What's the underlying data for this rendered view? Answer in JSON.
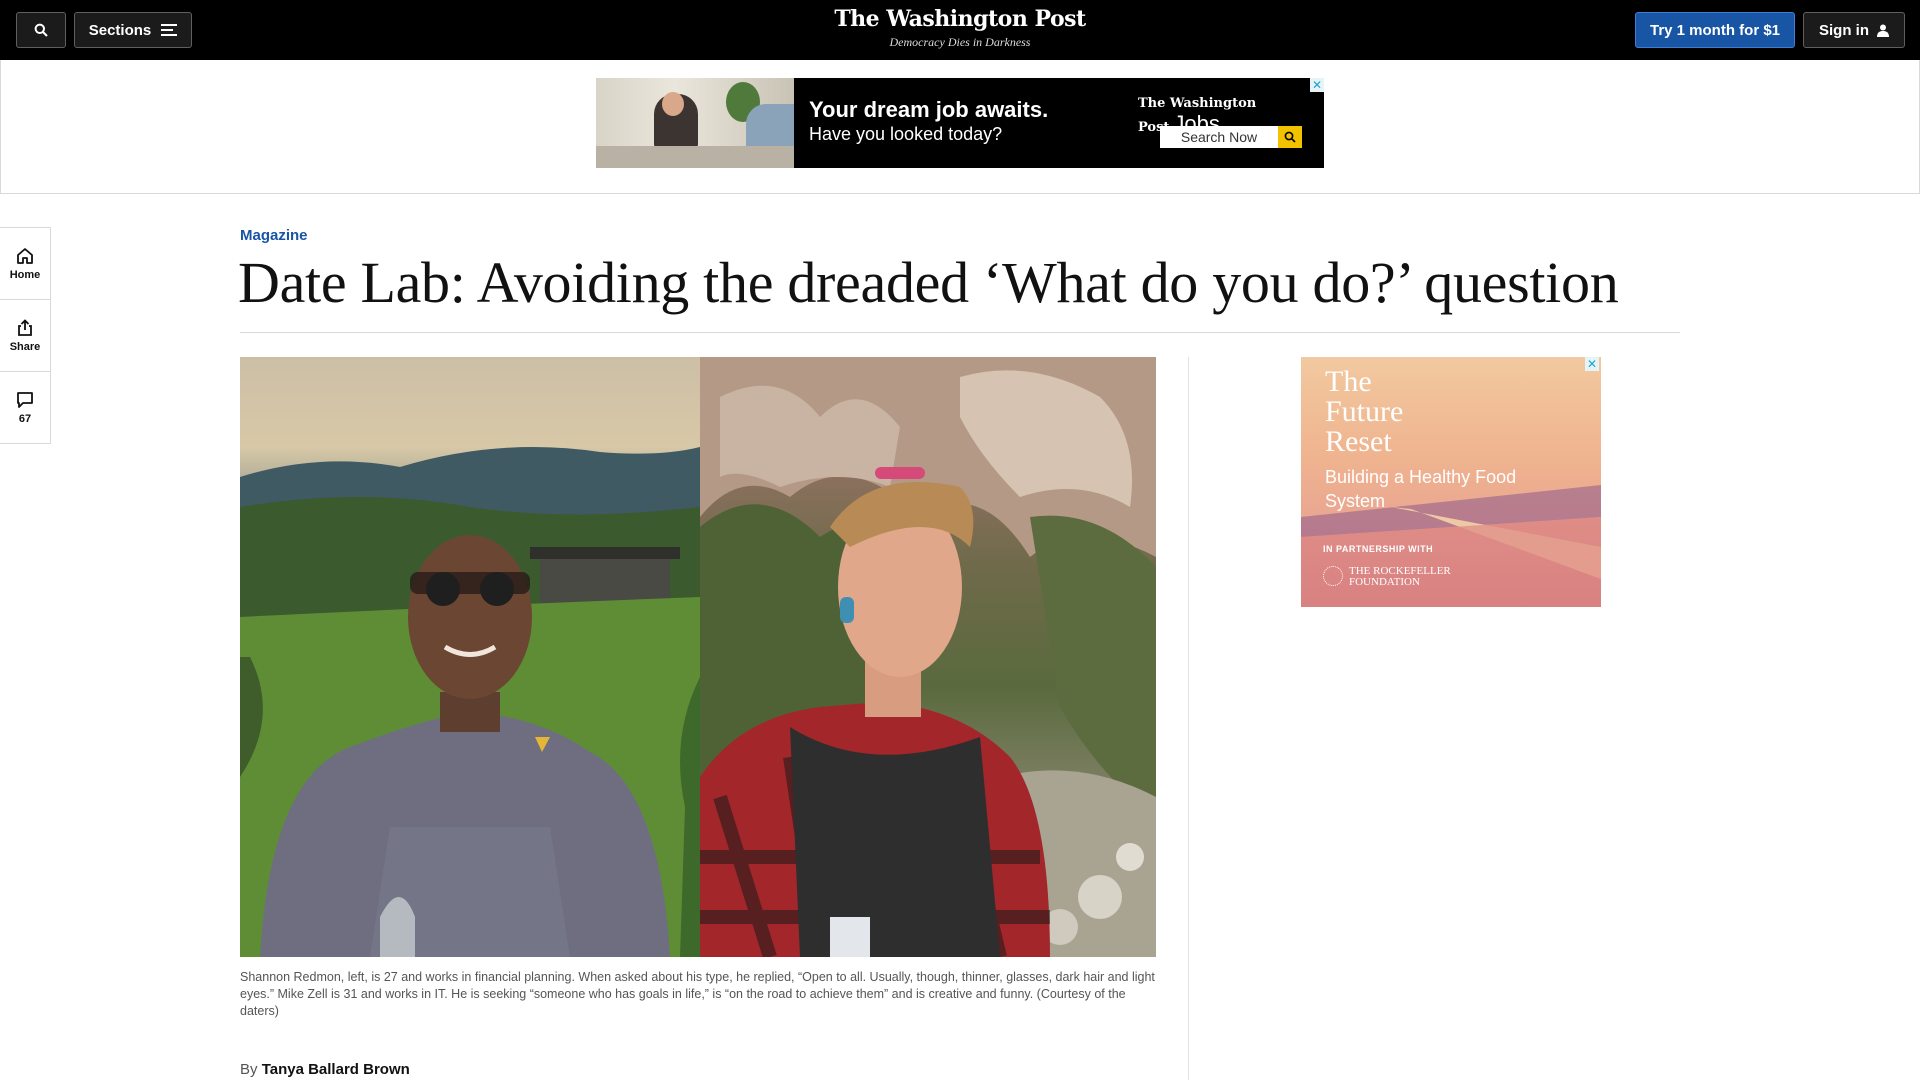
{
  "header": {
    "sections_label": "Sections",
    "logo": "The Washington Post",
    "tagline": "Democracy Dies in Darkness",
    "subscribe_label": "Try 1 month for $1",
    "signin_label": "Sign in"
  },
  "top_ad": {
    "headline": "Your dream job awaits.",
    "subline": "Have you looked today?",
    "brand": "The Washington Post",
    "brand_suffix": "Jobs",
    "search_label": "Search Now",
    "close_glyph": "✕"
  },
  "rail": {
    "home_label": "Home",
    "share_label": "Share",
    "comments_count": "67"
  },
  "article": {
    "kicker": "Magazine",
    "headline": "Date Lab: Avoiding the dreaded ‘What do you do?’ question",
    "caption": "Shannon Redmon, left, is 27 and works in financial planning. When asked about his type, he replied, “Open to all. Usually, though, thinner, glasses, dark hair and light eyes.” Mike Zell is 31 and works in IT. He is seeking “someone who has goals in life,” is “on the road to achieve them” and is creative and funny. (Courtesy of the daters)",
    "byline_prefix": "By",
    "author": "Tanya Ballard Brown"
  },
  "side_ad": {
    "title": "The\nFuture\nReset",
    "subtitle": "Building a Healthy Food System",
    "partner_label": "IN PARTNERSHIP WITH",
    "foundation": "THE ROCKEFELLER FOUNDATION",
    "close_glyph": "✕"
  },
  "colors": {
    "accent_blue": "#1955a5",
    "topbar": "#000000",
    "search_yellow": "#f2c200"
  },
  "icons": [
    "search-icon",
    "hamburger-icon",
    "user-icon",
    "home-icon",
    "share-icon",
    "comment-icon",
    "close-icon"
  ]
}
